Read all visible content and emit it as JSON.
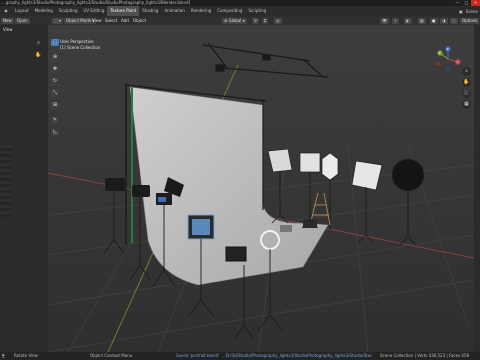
{
  "titlebar": {
    "text": "...graphy_lights3/StudioPhotography_lights3/Studio/StudioPhotography_lights3/Blender.blend]",
    "minimize": "—",
    "maximize": "□",
    "close": "✕"
  },
  "menubar": {
    "tabs": [
      "Layout",
      "Modeling",
      "Sculpting",
      "UV Editing",
      "Texture Paint",
      "Shading",
      "Animation",
      "Rendering",
      "Compositing",
      "Scripting"
    ],
    "active_tab": "Texture Paint",
    "scene_label": "Scene"
  },
  "left_panel": {
    "new_label": "New",
    "open_label": "Open",
    "view_label": "View"
  },
  "viewport_header": {
    "mode": "Object Mode",
    "view": "View",
    "select": "Select",
    "add": "Add",
    "object": "Object",
    "orientation": "Global",
    "options": "Options"
  },
  "viewport": {
    "perspective": "User Perspective",
    "collection": "(1) Scene Collection"
  },
  "gizmo": {
    "x": "X",
    "y": "Y",
    "z": "Z"
  },
  "statusbar": {
    "left": "Rotate View",
    "middle": "Object Context Menu",
    "saved": "Saved 'portrait.blend'",
    "path": "...D:/3d/Studio/Photography_lights3/StudioPhotography_lights3/Studio/StudioPhotography_lights3/Blender.blend",
    "right": "Scene Collection | Verts 436,523 | Faces 458"
  },
  "colors": {
    "accent": "#4a79b8",
    "axis_x": "#c0454a",
    "axis_y": "#7fa83a",
    "axis_z": "#3f75c9"
  }
}
